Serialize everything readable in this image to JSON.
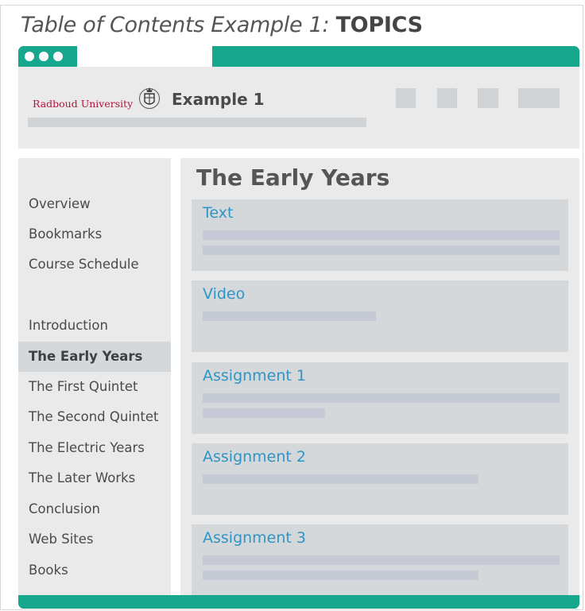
{
  "heading": {
    "prefix": "Table of Contents Example 1: ",
    "topic": "TOPICS"
  },
  "header": {
    "logo_text": "Radboud University",
    "site_title": "Example 1"
  },
  "sidebar": {
    "items": [
      {
        "label": "Overview"
      },
      {
        "label": "Bookmarks"
      },
      {
        "label": "Course Schedule"
      },
      {
        "label": "Introduction"
      },
      {
        "label": "The Early Years",
        "active": true
      },
      {
        "label": "The First Quintet"
      },
      {
        "label": "The Second Quintet"
      },
      {
        "label": "The Electric Years"
      },
      {
        "label": "The Later Works"
      },
      {
        "label": "Conclusion"
      },
      {
        "label": "Web Sites"
      },
      {
        "label": "Books"
      }
    ]
  },
  "main": {
    "title": "The Early Years",
    "cards": [
      {
        "title": "Text"
      },
      {
        "title": "Video"
      },
      {
        "title": "Assignment 1"
      },
      {
        "title": "Assignment 2"
      },
      {
        "title": "Assignment 3"
      }
    ]
  },
  "colors": {
    "accent": "#16a78c",
    "link": "#2f95c6",
    "brand": "#b3143a",
    "panel": "#eaeaea",
    "card": "#d4d8da"
  },
  "icons": {
    "window_controls": "dot-icon",
    "logo": "university-seal-icon"
  }
}
